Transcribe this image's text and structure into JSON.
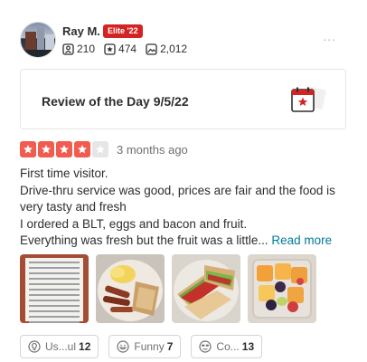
{
  "user": {
    "name": "Ray M.",
    "elite_badge": "Elite '22",
    "reviews": "210",
    "photos": "474",
    "friends": "2,012",
    "more_label": "..."
  },
  "rotd": {
    "label": "Review of the Day 9/5/22"
  },
  "review": {
    "rating": 4,
    "max_rating": 5,
    "date": "3 months ago",
    "lines": [
      "First time visitor.",
      "Drive-thru service was good, prices are fair and the food is",
      "very tasty and fresh",
      "I ordered a BLT, eggs and bacon and fruit.",
      "Everything was fresh but the fruit was a little..."
    ],
    "read_more": "Read more"
  },
  "photos": [
    {
      "name": "menu-photo"
    },
    {
      "name": "eggs-bacon-photo"
    },
    {
      "name": "blt-photo"
    },
    {
      "name": "fruit-photo"
    }
  ],
  "reactions": {
    "useful_label": "Us...ul",
    "useful_count": "12",
    "funny_label": "Funny",
    "funny_count": "7",
    "cool_label": "Co...",
    "cool_count": "13"
  },
  "colors": {
    "brand_red": "#d32323",
    "star": "#f15c4f",
    "link": "#027a97"
  }
}
